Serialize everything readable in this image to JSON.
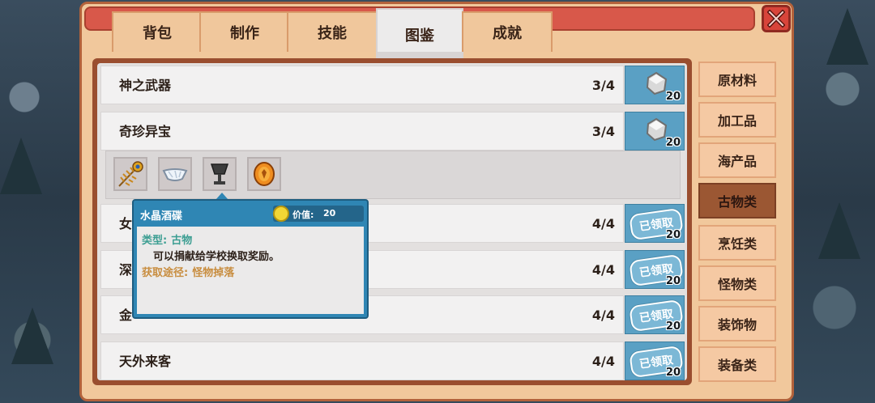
{
  "tabs": [
    {
      "label": "背包"
    },
    {
      "label": "制作"
    },
    {
      "label": "技能"
    },
    {
      "label": "图鉴"
    },
    {
      "label": "成就"
    }
  ],
  "rows": [
    {
      "name": "神之武器",
      "count": "3/4",
      "reward_amount": "20"
    },
    {
      "name": "奇珍异宝",
      "count": "3/4",
      "reward_amount": "20"
    },
    {
      "name": "女",
      "count": "4/4",
      "reward_amount": "20",
      "claimed": "已领取"
    },
    {
      "name": "深",
      "count": "4/4",
      "reward_amount": "20",
      "claimed": "已领取"
    },
    {
      "name": "金",
      "count": "4/4",
      "reward_amount": "20",
      "claimed": "已领取"
    },
    {
      "name": "天外来客",
      "count": "4/4",
      "reward_amount": "20",
      "claimed": "已领取"
    }
  ],
  "expanded_items": [
    {
      "icon": "peacock-feather-icon"
    },
    {
      "icon": "crystal-dish-icon"
    },
    {
      "icon": "goblet-icon"
    },
    {
      "icon": "amber-icon"
    }
  ],
  "categories": [
    {
      "label": "原材料"
    },
    {
      "label": "加工品"
    },
    {
      "label": "海产品"
    },
    {
      "label": "古物类",
      "active": true
    },
    {
      "label": "烹饪类"
    },
    {
      "label": "怪物类"
    },
    {
      "label": "装饰物"
    },
    {
      "label": "装备类"
    }
  ],
  "tooltip": {
    "title": "水晶酒碟",
    "price_label": "价值:",
    "price_value": "20",
    "type_label": "类型:",
    "type_value": "古物",
    "description": "可以捐献给学校换取奖励。",
    "source_label": "获取途径:",
    "source_value": "怪物掉落"
  },
  "colors": {
    "panel": "#f1c89c",
    "tab_active": "#ecebeb",
    "reward_bg": "#5aa0c4",
    "category_active": "#9b5733",
    "tooltip_bg": "#2f86b4",
    "close_button": "#d8443a"
  }
}
